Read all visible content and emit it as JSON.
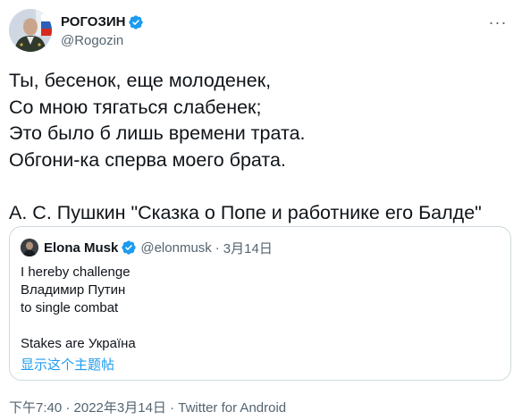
{
  "author": {
    "display_name": "РОГОЗИН",
    "handle": "@Rogozin",
    "verified": true,
    "avatar_icon": "profile-photo"
  },
  "menu": {
    "more_icon": "more-dots-icon",
    "more_glyph": "···"
  },
  "tweet": {
    "text": "Ты, бесенок, еще молоденек,\nСо мною тягаться слабенек;\nЭто было б лишь времени трата.\nОбгони-ка сперва моего брата.\n\nА. С. Пушкин \"Сказка о Попе и работнике его Балде\""
  },
  "quoted_tweet": {
    "display_name": "Elona Musk",
    "handle": "@elonmusk",
    "separator": "·",
    "date": "3月14日",
    "verified": true,
    "text": "I hereby challenge\nВладимир Путин\nto single combat\n\nStakes are Україна",
    "show_thread_link": "显示这个主题帖"
  },
  "footer": {
    "meta": "下午7:40 · 2022年3月14日 · Twitter for Android"
  },
  "colors": {
    "verified_blue": "#1d9bf0",
    "link_blue": "#1d9bf0",
    "secondary_text": "#536471",
    "border": "#cfd9de"
  }
}
